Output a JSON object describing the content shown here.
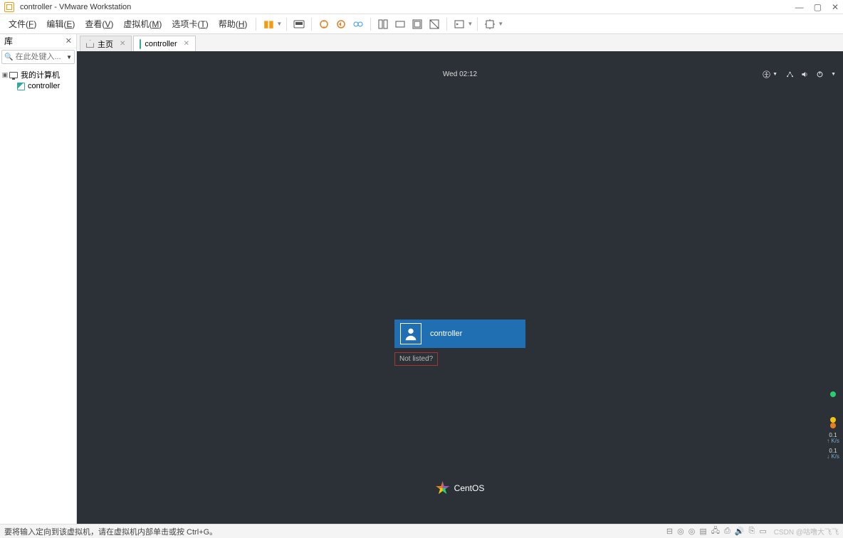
{
  "titlebar": {
    "title": "controller - VMware Workstation"
  },
  "menu": {
    "file": "文件(",
    "file_u": "F",
    "file_e": ")",
    "edit": "编辑(",
    "edit_u": "E",
    "edit_e": ")",
    "view": "查看(",
    "view_u": "V",
    "view_e": ")",
    "vm": "虚拟机(",
    "vm_u": "M",
    "vm_e": ")",
    "tabs": "选项卡(",
    "tabs_u": "T",
    "tabs_e": ")",
    "help": "帮助(",
    "help_u": "H",
    "help_e": ")"
  },
  "library": {
    "title": "库",
    "search_placeholder": "在此处键入...",
    "root": "我的计算机",
    "vm": "controller"
  },
  "tabs": {
    "home": "主页",
    "vm": "controller"
  },
  "gnome": {
    "clock": "Wed 02:12"
  },
  "login": {
    "user": "controller",
    "not_listed": "Not listed?"
  },
  "brand": {
    "name": "CentOS"
  },
  "netwidget": {
    "up_v": "0.1",
    "up_u": "K/s",
    "dn_v": "0.1",
    "dn_u": "K/s"
  },
  "statusbar": {
    "message": "要将输入定向到该虚拟机，请在虚拟机内部单击或按 Ctrl+G。",
    "watermark": "CSDN @咕噜大飞飞"
  }
}
